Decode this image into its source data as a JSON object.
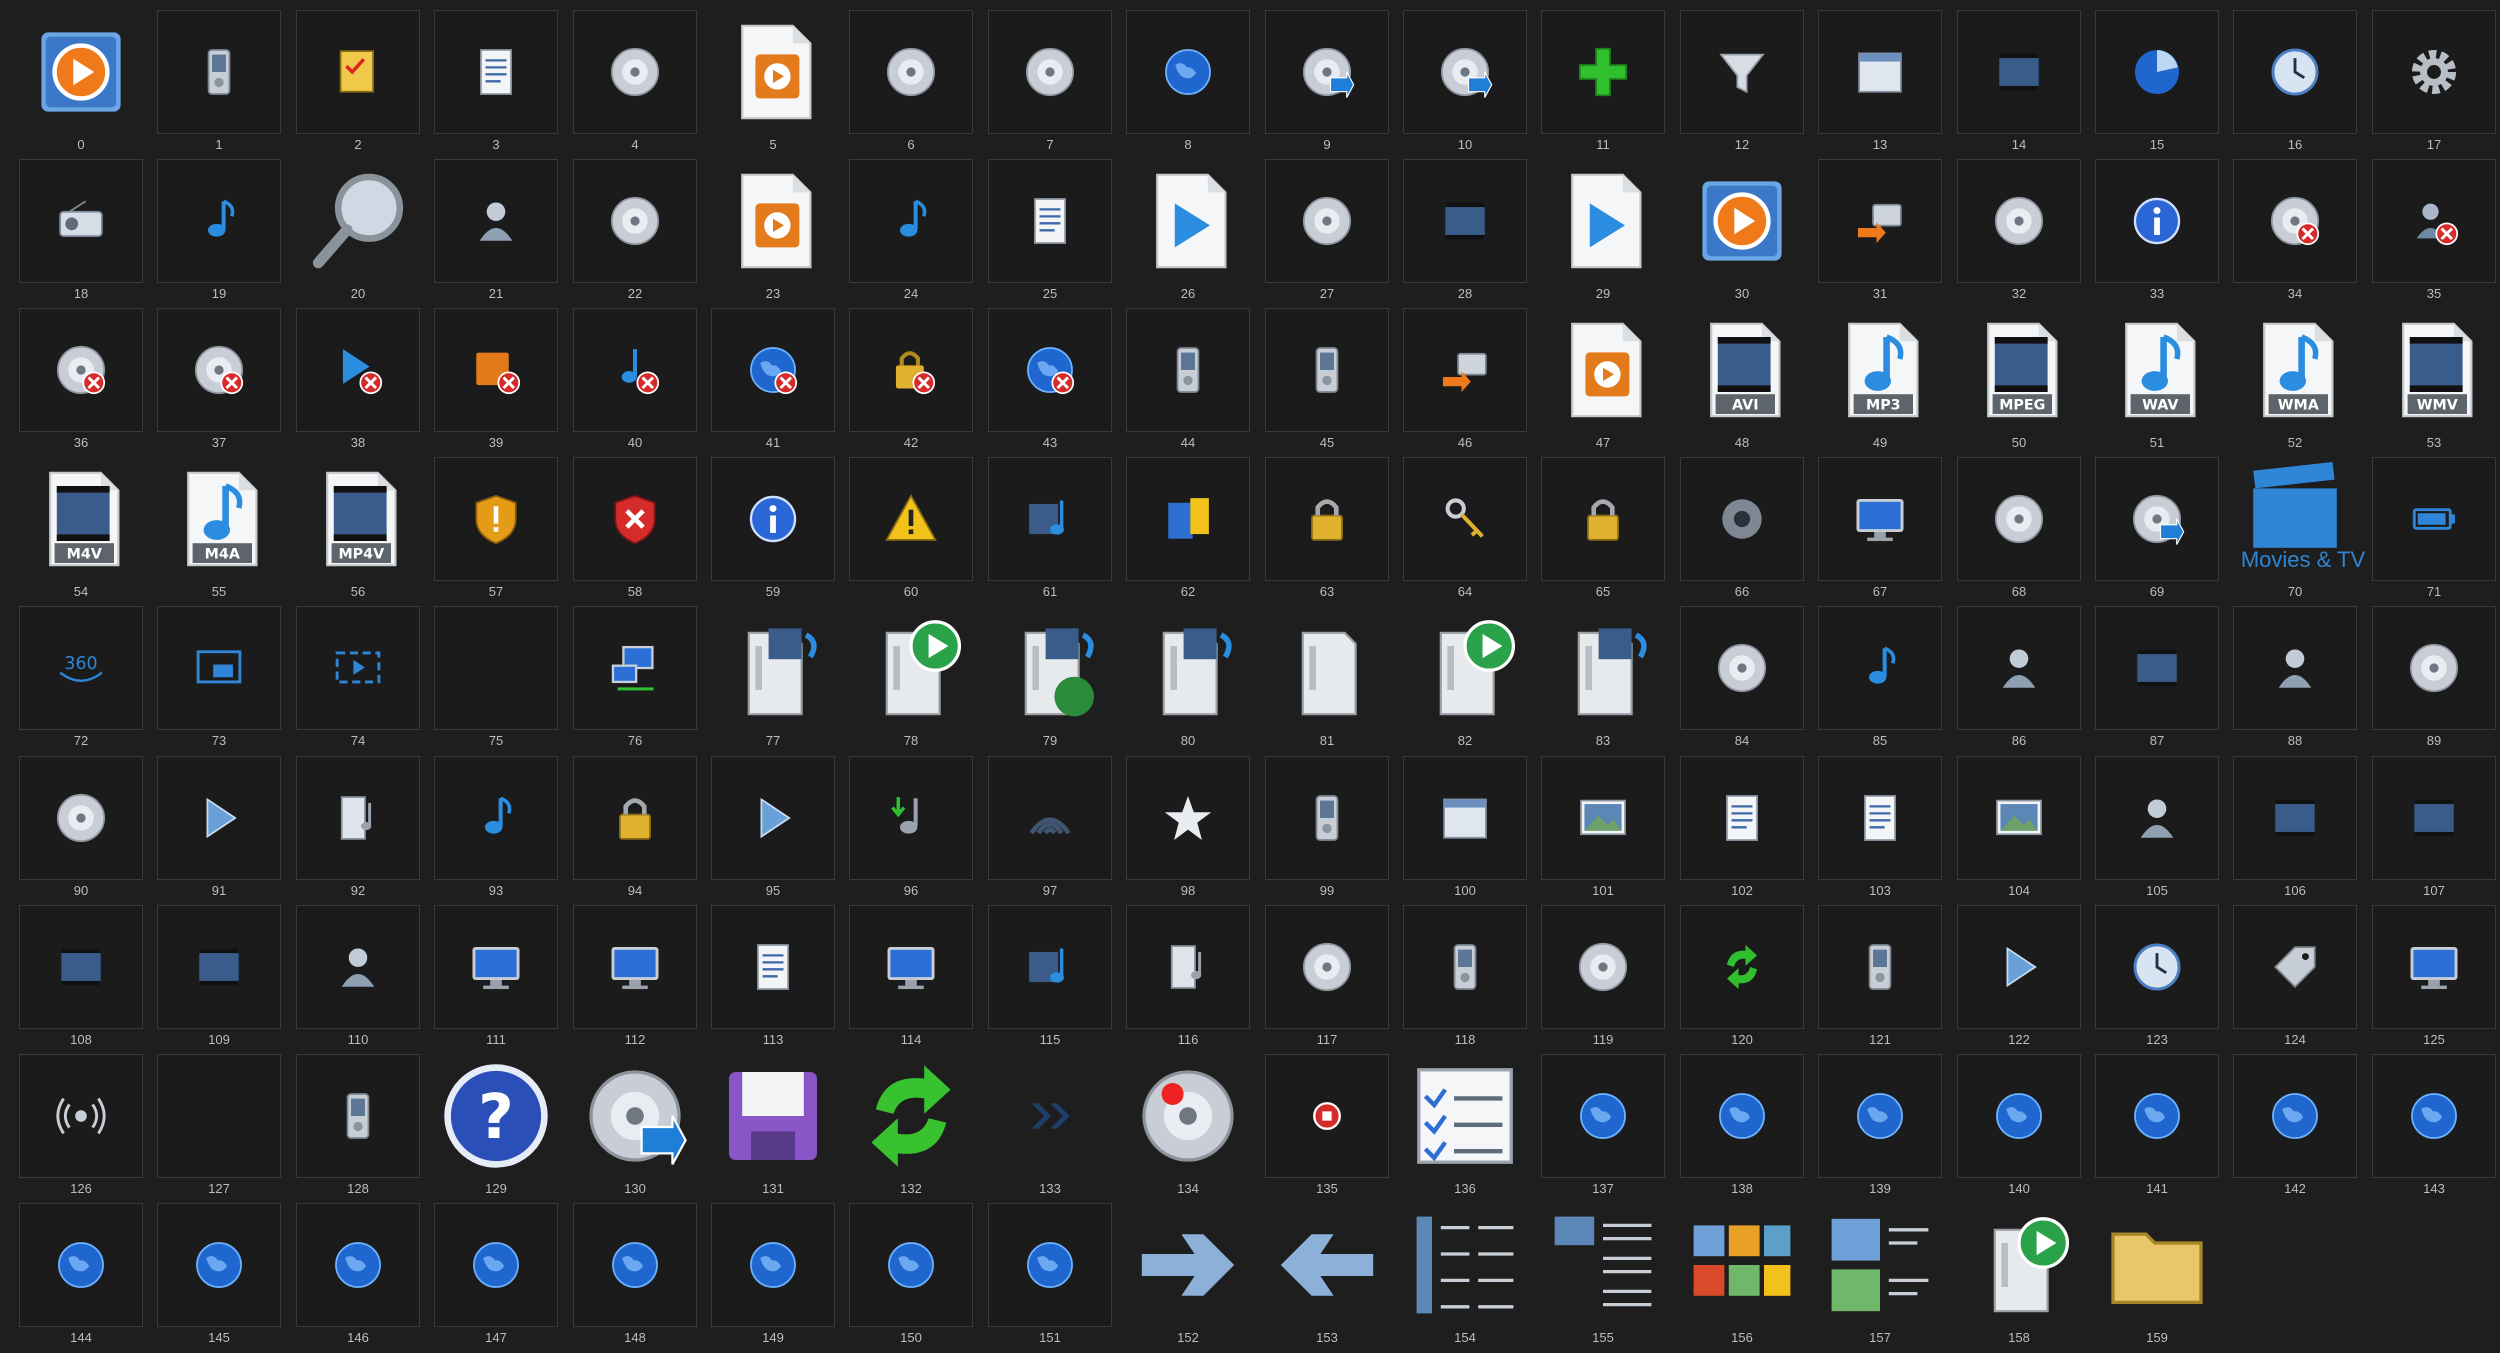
{
  "icons": [
    {
      "label": "0",
      "icon": "media-player-icon"
    },
    {
      "label": "1",
      "icon": "portable-device-icon"
    },
    {
      "label": "2",
      "icon": "sync-list-icon"
    },
    {
      "label": "3",
      "icon": "document-list-icon"
    },
    {
      "label": "4",
      "icon": "cd-icon"
    },
    {
      "label": "5",
      "icon": "media-file-icon"
    },
    {
      "label": "6",
      "icon": "dvd-icon"
    },
    {
      "label": "7",
      "icon": "cd-icon"
    },
    {
      "label": "8",
      "icon": "globe-network-icon"
    },
    {
      "label": "9",
      "icon": "cd-rip-icon"
    },
    {
      "label": "10",
      "icon": "cd-burn-icon"
    },
    {
      "label": "11",
      "icon": "add-icon"
    },
    {
      "label": "12",
      "icon": "filter-icon"
    },
    {
      "label": "13",
      "icon": "calendar-icon"
    },
    {
      "label": "14",
      "icon": "video-icon"
    },
    {
      "label": "15",
      "icon": "pie-chart-icon"
    },
    {
      "label": "16",
      "icon": "clock-icon"
    },
    {
      "label": "17",
      "icon": "gear-icon"
    },
    {
      "label": "18",
      "icon": "radio-icon"
    },
    {
      "label": "19",
      "icon": "music-note-icon"
    },
    {
      "label": "20",
      "icon": "magnifier-icon"
    },
    {
      "label": "21",
      "icon": "user-icon"
    },
    {
      "label": "22",
      "icon": "cd-icon"
    },
    {
      "label": "23",
      "icon": "media-file-icon"
    },
    {
      "label": "24",
      "icon": "music-note-icon"
    },
    {
      "label": "25",
      "icon": "document-arrow-icon"
    },
    {
      "label": "26",
      "icon": "play-file-icon"
    },
    {
      "label": "27",
      "icon": "cd-stack-icon"
    },
    {
      "label": "28",
      "icon": "video-icon"
    },
    {
      "label": "29",
      "icon": "play-file-icon"
    },
    {
      "label": "30",
      "icon": "media-player-icon"
    },
    {
      "label": "31",
      "icon": "drive-transfer-icon"
    },
    {
      "label": "32",
      "icon": "cd-document-icon"
    },
    {
      "label": "33",
      "icon": "info-cursor-icon"
    },
    {
      "label": "34",
      "icon": "cd-error-icon"
    },
    {
      "label": "35",
      "icon": "user-error-icon"
    },
    {
      "label": "36",
      "icon": "cd-error-icon"
    },
    {
      "label": "37",
      "icon": "cd-error-icon"
    },
    {
      "label": "38",
      "icon": "play-error-icon"
    },
    {
      "label": "39",
      "icon": "media-error-icon"
    },
    {
      "label": "40",
      "icon": "music-error-icon"
    },
    {
      "label": "41",
      "icon": "globe-error-icon"
    },
    {
      "label": "42",
      "icon": "lock-error-icon"
    },
    {
      "label": "43",
      "icon": "globe-error-icon"
    },
    {
      "label": "44",
      "icon": "portable-device-icon"
    },
    {
      "label": "45",
      "icon": "device-sync-icon"
    },
    {
      "label": "46",
      "icon": "drive-transfer-icon"
    },
    {
      "label": "47",
      "icon": "media-file-icon",
      "ext": ""
    },
    {
      "label": "48",
      "icon": "video-file-icon",
      "ext": "AVI"
    },
    {
      "label": "49",
      "icon": "music-file-icon",
      "ext": "MP3"
    },
    {
      "label": "50",
      "icon": "video-file-icon",
      "ext": "MPEG"
    },
    {
      "label": "51",
      "icon": "music-file-icon",
      "ext": "WAV"
    },
    {
      "label": "52",
      "icon": "music-file-icon",
      "ext": "WMA"
    },
    {
      "label": "53",
      "icon": "video-file-icon",
      "ext": "WMV"
    },
    {
      "label": "54",
      "icon": "video-file-icon",
      "ext": "M4V"
    },
    {
      "label": "55",
      "icon": "music-file-icon",
      "ext": "M4A"
    },
    {
      "label": "56",
      "icon": "video-file-icon",
      "ext": "MP4V"
    },
    {
      "label": "57",
      "icon": "shield-warning-icon"
    },
    {
      "label": "58",
      "icon": "shield-error-icon"
    },
    {
      "label": "59",
      "icon": "info-icon"
    },
    {
      "label": "60",
      "icon": "warning-icon"
    },
    {
      "label": "61",
      "icon": "media-icon"
    },
    {
      "label": "62",
      "icon": "package-icon"
    },
    {
      "label": "63",
      "icon": "lock-icon"
    },
    {
      "label": "64",
      "icon": "keys-icon"
    },
    {
      "label": "65",
      "icon": "lock-icon"
    },
    {
      "label": "66",
      "icon": "speaker-icon"
    },
    {
      "label": "67",
      "icon": "monitor-icon"
    },
    {
      "label": "68",
      "icon": "cd-user-icon"
    },
    {
      "label": "69",
      "icon": "cd-rip-icon"
    },
    {
      "label": "70",
      "icon": "clapperboard-icon",
      "caption": "Movies & TV"
    },
    {
      "label": "71",
      "icon": "battery-icon"
    },
    {
      "label": "72",
      "icon": "view-360-icon"
    },
    {
      "label": "73",
      "icon": "picture-in-picture-icon"
    },
    {
      "label": "74",
      "icon": "play-window-icon"
    },
    {
      "label": "75",
      "icon": "blank-icon"
    },
    {
      "label": "76",
      "icon": "network-computers-icon"
    },
    {
      "label": "77",
      "icon": "media-server-icon"
    },
    {
      "label": "78",
      "icon": "server-play-icon"
    },
    {
      "label": "79",
      "icon": "media-server-globe-icon"
    },
    {
      "label": "80",
      "icon": "media-server-icon"
    },
    {
      "label": "81",
      "icon": "server-icon"
    },
    {
      "label": "82",
      "icon": "server-play-icon"
    },
    {
      "label": "83",
      "icon": "media-server-icon"
    },
    {
      "label": "84",
      "icon": "cd-icon"
    },
    {
      "label": "85",
      "icon": "music-note-icon"
    },
    {
      "label": "86",
      "icon": "users-icon"
    },
    {
      "label": "87",
      "icon": "video-play-icon"
    },
    {
      "label": "88",
      "icon": "user-music-icon"
    },
    {
      "label": "89",
      "icon": "cd-user-icon"
    },
    {
      "label": "90",
      "icon": "cd-stack-icon"
    },
    {
      "label": "91",
      "icon": "play-icon"
    },
    {
      "label": "92",
      "icon": "book-music-icon"
    },
    {
      "label": "93",
      "icon": "music-note-icon"
    },
    {
      "label": "94",
      "icon": "lock-icon"
    },
    {
      "label": "95",
      "icon": "play-document-icon"
    },
    {
      "label": "96",
      "icon": "music-download-icon"
    },
    {
      "label": "97",
      "icon": "wireless-icon"
    },
    {
      "label": "98",
      "icon": "star-icon"
    },
    {
      "label": "99",
      "icon": "device-icon"
    },
    {
      "label": "100",
      "icon": "calendar-icon"
    },
    {
      "label": "101",
      "icon": "picture-icon"
    },
    {
      "label": "102",
      "icon": "document-icon"
    },
    {
      "label": "103",
      "icon": "documents-icon"
    },
    {
      "label": "104",
      "icon": "picture-icon"
    },
    {
      "label": "105",
      "icon": "user-icon"
    },
    {
      "label": "106",
      "icon": "video-icon"
    },
    {
      "label": "107",
      "icon": "video-download-icon"
    },
    {
      "label": "108",
      "icon": "video-stack-icon"
    },
    {
      "label": "109",
      "icon": "book-video-icon"
    },
    {
      "label": "110",
      "icon": "user-icon"
    },
    {
      "label": "111",
      "icon": "monitor-icon"
    },
    {
      "label": "112",
      "icon": "monitors-icon"
    },
    {
      "label": "113",
      "icon": "documents-icon"
    },
    {
      "label": "114",
      "icon": "monitors-icon"
    },
    {
      "label": "115",
      "icon": "media-icon"
    },
    {
      "label": "116",
      "icon": "book-music-icon"
    },
    {
      "label": "117",
      "icon": "cd-music-icon"
    },
    {
      "label": "118",
      "icon": "portable-device-icon"
    },
    {
      "label": "119",
      "icon": "cd-video-icon"
    },
    {
      "label": "120",
      "icon": "refresh-icon"
    },
    {
      "label": "121",
      "icon": "device-transfer-icon"
    },
    {
      "label": "122",
      "icon": "play-new-icon"
    },
    {
      "label": "123",
      "icon": "clock-icon"
    },
    {
      "label": "124",
      "icon": "tag-icon"
    },
    {
      "label": "125",
      "icon": "monitor-download-icon"
    },
    {
      "label": "126",
      "icon": "broadcast-icon"
    },
    {
      "label": "127",
      "icon": "blank-icon"
    },
    {
      "label": "128",
      "icon": "device-globe-icon"
    },
    {
      "label": "129",
      "icon": "help-icon"
    },
    {
      "label": "130",
      "icon": "cd-rip-large-icon"
    },
    {
      "label": "131",
      "icon": "floppy-disk-icon"
    },
    {
      "label": "132",
      "icon": "sync-arrows-icon"
    },
    {
      "label": "133",
      "icon": "double-chevron-icon"
    },
    {
      "label": "134",
      "icon": "cd-record-icon"
    },
    {
      "label": "135",
      "icon": "stop-icon"
    },
    {
      "label": "136",
      "icon": "checklist-icon"
    },
    {
      "label": "137",
      "icon": "globe-icon"
    },
    {
      "label": "138",
      "icon": "globe-icon"
    },
    {
      "label": "139",
      "icon": "globe-icon"
    },
    {
      "label": "140",
      "icon": "globe-icon"
    },
    {
      "label": "141",
      "icon": "globe-icon"
    },
    {
      "label": "142",
      "icon": "globe-icon"
    },
    {
      "label": "143",
      "icon": "globe-icon"
    },
    {
      "label": "144",
      "icon": "globe-icon"
    },
    {
      "label": "145",
      "icon": "globe-icon"
    },
    {
      "label": "146",
      "icon": "globe-icon"
    },
    {
      "label": "147",
      "icon": "globe-icon"
    },
    {
      "label": "148",
      "icon": "globe-icon"
    },
    {
      "label": "149",
      "icon": "globe-icon"
    },
    {
      "label": "150",
      "icon": "globe-icon"
    },
    {
      "label": "151",
      "icon": "globe-icon"
    },
    {
      "label": "152",
      "icon": "arrow-right-icon"
    },
    {
      "label": "153",
      "icon": "arrow-left-icon"
    },
    {
      "label": "154",
      "icon": "details-view-icon"
    },
    {
      "label": "155",
      "icon": "list-view-icon"
    },
    {
      "label": "156",
      "icon": "tiles-view-icon"
    },
    {
      "label": "157",
      "icon": "content-view-icon"
    },
    {
      "label": "158",
      "icon": "server-play-icon"
    },
    {
      "label": "159",
      "icon": "folder-icon"
    }
  ],
  "colors": {
    "background": "#1e1e1e",
    "tile_border": "#3a3a3a",
    "label_text": "#bdbdbd",
    "accent_blue": "#2f86d6"
  }
}
